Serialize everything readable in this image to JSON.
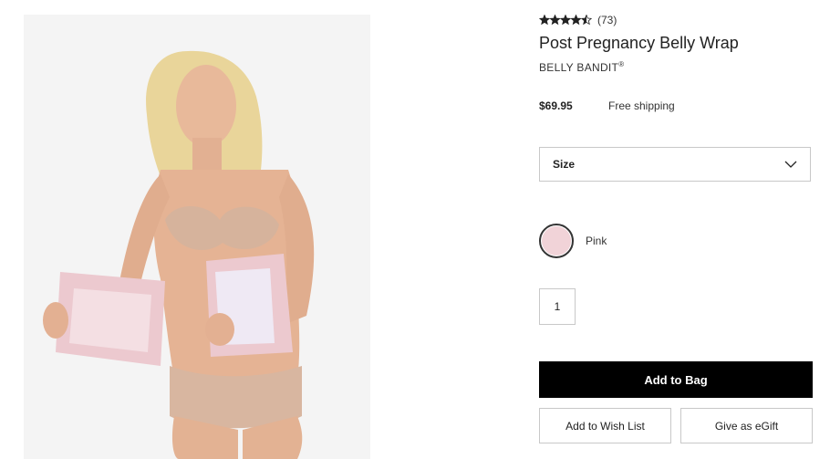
{
  "product": {
    "rating_value": 4.5,
    "rating_count": "(73)",
    "title": "Post Pregnancy Belly Wrap",
    "brand": "BELLY BANDIT",
    "brand_mark": "®",
    "price": "$69.95",
    "shipping": "Free shipping"
  },
  "size_select": {
    "label": "Size"
  },
  "color": {
    "name": "Pink",
    "swatch": "#f1d3d8"
  },
  "quantity": "1",
  "actions": {
    "add_to_bag": "Add to Bag",
    "wish_list": "Add to Wish List",
    "egift": "Give as eGift"
  },
  "colors": {
    "primary_button": "#000000",
    "border": "#c8c8c8",
    "wrap_pink": "#ecc9cf"
  }
}
